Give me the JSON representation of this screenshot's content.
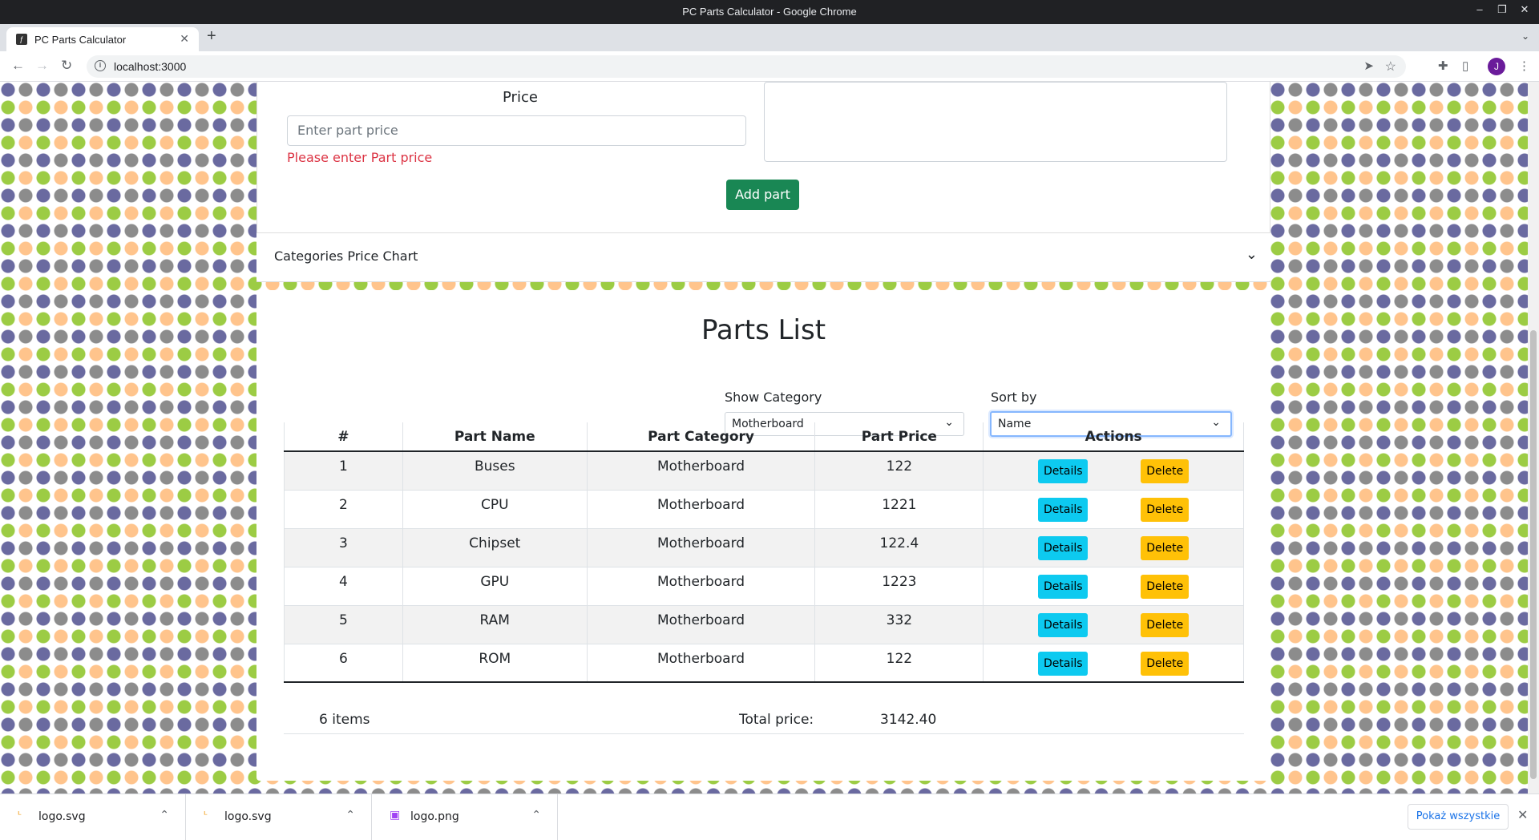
{
  "window": {
    "title": "PC Parts Calculator - Google Chrome"
  },
  "tab": {
    "title": "PC Parts Calculator",
    "new_tab": "+"
  },
  "address": {
    "url": "localhost:3000",
    "avatar_letter": "J"
  },
  "form": {
    "price_label": "Price",
    "price_placeholder": "Enter part price",
    "price_error": "Please enter Part price",
    "add_button": "Add part"
  },
  "accordion": {
    "title": "Categories Price Chart"
  },
  "parts_list": {
    "title": "Parts List",
    "show_category_label": "Show Category",
    "show_category_value": "Motherboard",
    "sort_by_label": "Sort by",
    "sort_by_value": "Name",
    "columns": [
      "#",
      "Part Name",
      "Part Category",
      "Part Price",
      "Actions"
    ],
    "rows": [
      {
        "num": "1",
        "name": "Buses",
        "category": "Motherboard",
        "price": "122"
      },
      {
        "num": "2",
        "name": "CPU",
        "category": "Motherboard",
        "price": "1221"
      },
      {
        "num": "3",
        "name": "Chipset",
        "category": "Motherboard",
        "price": "122.4"
      },
      {
        "num": "4",
        "name": "GPU",
        "category": "Motherboard",
        "price": "1223"
      },
      {
        "num": "5",
        "name": "RAM",
        "category": "Motherboard",
        "price": "332"
      },
      {
        "num": "6",
        "name": "ROM",
        "category": "Motherboard",
        "price": "122"
      }
    ],
    "details_label": "Details",
    "delete_label": "Delete",
    "items_count": "6 items",
    "total_label": "Total price:",
    "total_value": "3142.40"
  },
  "downloads": {
    "items": [
      {
        "name": "logo.svg",
        "icon": "svg-file-icon"
      },
      {
        "name": "logo.svg",
        "icon": "svg-file-icon"
      },
      {
        "name": "logo.png",
        "icon": "image-file-icon"
      }
    ],
    "show_all": "Pokaż wszystkie"
  },
  "colors": {
    "success": "#198754",
    "danger": "#dc3545",
    "info": "#0dcaf0",
    "warning": "#ffc107"
  }
}
